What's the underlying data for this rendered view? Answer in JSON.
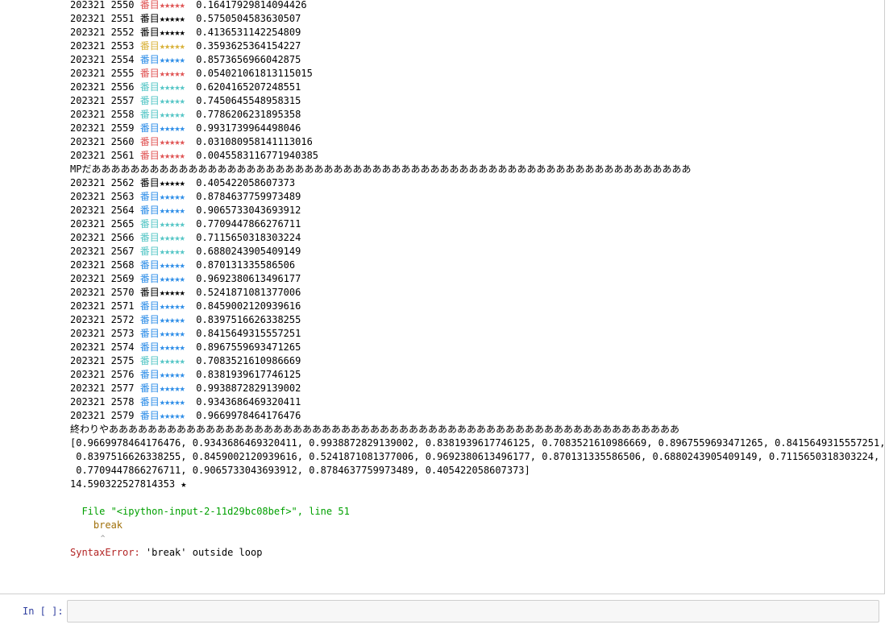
{
  "colors": {
    "red": "#e05555",
    "black": "#000000",
    "gold": "#d9b23a",
    "blue": "#2e8ee8",
    "teal": "#55c6c6",
    "traceback_green": "#00a000",
    "code_brown": "#a0700a",
    "error_red": "#b22222",
    "prompt_blue": "#303f9f"
  },
  "result_lines_1": [
    {
      "prefix": "202321 2550 ",
      "label": "番目",
      "stars": "★★★★★",
      "value": "0.16417929814094426",
      "color": "red"
    },
    {
      "prefix": "202321 2551 ",
      "label": "番目",
      "stars": "★★★★★",
      "value": "0.5750504583630507",
      "color": "black"
    },
    {
      "prefix": "202321 2552 ",
      "label": "番目",
      "stars": "★★★★★",
      "value": "0.4136531142254809",
      "color": "black"
    },
    {
      "prefix": "202321 2553 ",
      "label": "番目",
      "stars": "★★★★★",
      "value": "0.3593625364154227",
      "color": "gold"
    },
    {
      "prefix": "202321 2554 ",
      "label": "番目",
      "stars": "★★★★★",
      "value": "0.8573656966042875",
      "color": "blue"
    },
    {
      "prefix": "202321 2555 ",
      "label": "番目",
      "stars": "★★★★★",
      "value": "0.054021061813115015",
      "color": "red"
    },
    {
      "prefix": "202321 2556 ",
      "label": "番目",
      "stars": "★★★★★",
      "value": "0.6204165207248551",
      "color": "teal"
    },
    {
      "prefix": "202321 2557 ",
      "label": "番目",
      "stars": "★★★★★",
      "value": "0.7450645548958315",
      "color": "teal"
    },
    {
      "prefix": "202321 2558 ",
      "label": "番目",
      "stars": "★★★★★",
      "value": "0.7786206231895358",
      "color": "teal"
    },
    {
      "prefix": "202321 2559 ",
      "label": "番目",
      "stars": "★★★★★",
      "value": "0.9931739964498046",
      "color": "blue"
    },
    {
      "prefix": "202321 2560 ",
      "label": "番目",
      "stars": "★★★★★",
      "value": "0.031080958141113016",
      "color": "red"
    },
    {
      "prefix": "202321 2561 ",
      "label": "番目",
      "stars": "★★★★★",
      "value": "0.0045583116771940385",
      "color": "red"
    }
  ],
  "mp_line": "MPだああああああああああああああああああああああああああああああああああああああああああああああああああああああああああああああ",
  "result_lines_2": [
    {
      "prefix": "202321 2562 ",
      "label": "番目",
      "stars": "★★★★★",
      "value": "0.405422058607373",
      "color": "black"
    },
    {
      "prefix": "202321 2563 ",
      "label": "番目",
      "stars": "★★★★★",
      "value": "0.8784637759973489",
      "color": "blue"
    },
    {
      "prefix": "202321 2564 ",
      "label": "番目",
      "stars": "★★★★★",
      "value": "0.9065733043693912",
      "color": "blue"
    },
    {
      "prefix": "202321 2565 ",
      "label": "番目",
      "stars": "★★★★★",
      "value": "0.7709447866276711",
      "color": "teal"
    },
    {
      "prefix": "202321 2566 ",
      "label": "番目",
      "stars": "★★★★★",
      "value": "0.7115650318303224",
      "color": "teal"
    },
    {
      "prefix": "202321 2567 ",
      "label": "番目",
      "stars": "★★★★★",
      "value": "0.6880243905409149",
      "color": "teal"
    },
    {
      "prefix": "202321 2568 ",
      "label": "番目",
      "stars": "★★★★★",
      "value": "0.870131335586506",
      "color": "blue"
    },
    {
      "prefix": "202321 2569 ",
      "label": "番目",
      "stars": "★★★★★",
      "value": "0.9692380613496177",
      "color": "blue"
    },
    {
      "prefix": "202321 2570 ",
      "label": "番目",
      "stars": "★★★★★",
      "value": "0.5241871081377006",
      "color": "black"
    },
    {
      "prefix": "202321 2571 ",
      "label": "番目",
      "stars": "★★★★★",
      "value": "0.8459002120939616",
      "color": "blue"
    },
    {
      "prefix": "202321 2572 ",
      "label": "番目",
      "stars": "★★★★★",
      "value": "0.8397516626338255",
      "color": "blue"
    },
    {
      "prefix": "202321 2573 ",
      "label": "番目",
      "stars": "★★★★★",
      "value": "0.8415649315557251",
      "color": "blue"
    },
    {
      "prefix": "202321 2574 ",
      "label": "番目",
      "stars": "★★★★★",
      "value": "0.8967559693471265",
      "color": "blue"
    },
    {
      "prefix": "202321 2575 ",
      "label": "番目",
      "stars": "★★★★★",
      "value": "0.7083521610986669",
      "color": "teal"
    },
    {
      "prefix": "202321 2576 ",
      "label": "番目",
      "stars": "★★★★★",
      "value": "0.8381939617746125",
      "color": "blue"
    },
    {
      "prefix": "202321 2577 ",
      "label": "番目",
      "stars": "★★★★★",
      "value": "0.9938872829139002",
      "color": "blue"
    },
    {
      "prefix": "202321 2578 ",
      "label": "番目",
      "stars": "★★★★★",
      "value": "0.9343686469320411",
      "color": "blue"
    },
    {
      "prefix": "202321 2579 ",
      "label": "番目",
      "stars": "★★★★★",
      "value": "0.9669978464176476",
      "color": "blue"
    }
  ],
  "end_line": "終わりやあああああああああああああああああああああああああああああああああああああああああああああああああああああああああああ",
  "list_output": [
    "[0.9669978464176476, 0.9343686469320411, 0.9938872829139002, 0.8381939617746125, 0.7083521610986669, 0.8967559693471265, 0.8415649315557251,",
    " 0.8397516626338255, 0.8459002120939616, 0.5241871081377006, 0.9692380613496177, 0.870131335586506, 0.6880243905409149, 0.7115650318303224,",
    " 0.7709447866276711, 0.9065733043693912, 0.8784637759973489, 0.405422058607373]"
  ],
  "total_line": "14.590322527814353 ★",
  "traceback": {
    "file_prefix": "  File ",
    "file_path": "\"<ipython-input-2-11d29bc08bef>\"",
    "line_suffix": ", line 51",
    "code_line": "    break",
    "caret": "       ^",
    "error_name": "SyntaxError:",
    "error_message": " 'break' outside loop"
  },
  "input_cell": {
    "prompt": "In [ ]:",
    "value": ""
  }
}
